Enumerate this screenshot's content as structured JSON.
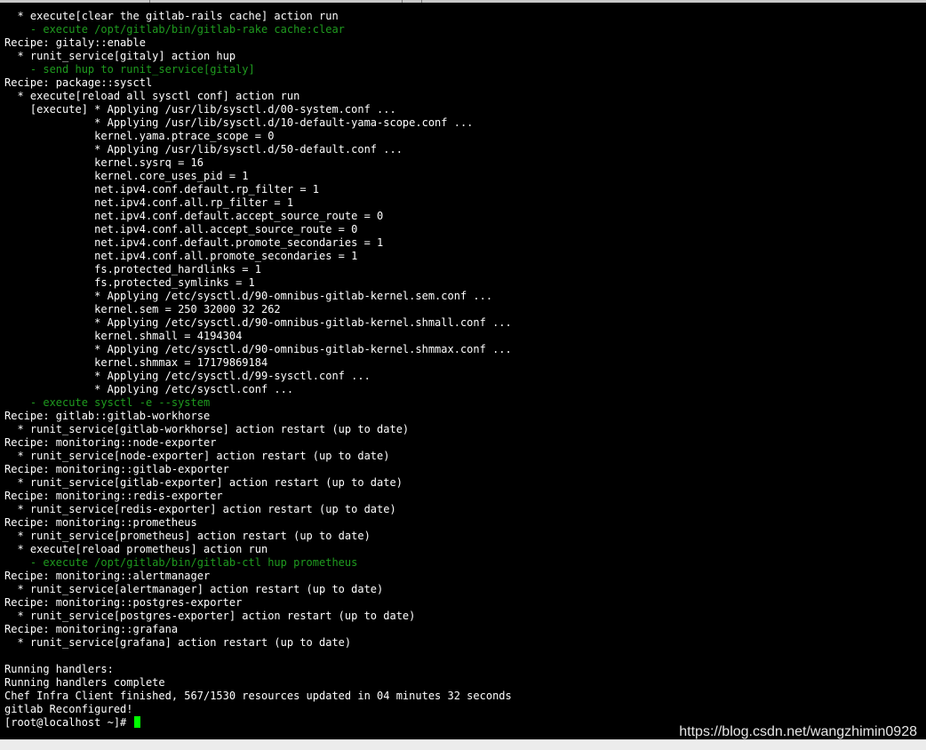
{
  "terminal": {
    "text_color": "#ffffff",
    "dim_color": "#1f9b1f",
    "cursor_color": "#00ff00",
    "lines": [
      {
        "text": "  * execute[clear the gitlab-rails cache] action run",
        "style": "normal"
      },
      {
        "text": "    - execute /opt/gitlab/bin/gitlab-rake cache:clear",
        "style": "green"
      },
      {
        "text": "Recipe: gitaly::enable",
        "style": "normal"
      },
      {
        "text": "  * runit_service[gitaly] action hup",
        "style": "normal"
      },
      {
        "text": "    - send hup to runit_service[gitaly]",
        "style": "green"
      },
      {
        "text": "Recipe: package::sysctl",
        "style": "normal"
      },
      {
        "text": "  * execute[reload all sysctl conf] action run",
        "style": "normal"
      },
      {
        "text": "    [execute] * Applying /usr/lib/sysctl.d/00-system.conf ...",
        "style": "normal"
      },
      {
        "text": "              * Applying /usr/lib/sysctl.d/10-default-yama-scope.conf ...",
        "style": "normal"
      },
      {
        "text": "              kernel.yama.ptrace_scope = 0",
        "style": "normal"
      },
      {
        "text": "              * Applying /usr/lib/sysctl.d/50-default.conf ...",
        "style": "normal"
      },
      {
        "text": "              kernel.sysrq = 16",
        "style": "normal"
      },
      {
        "text": "              kernel.core_uses_pid = 1",
        "style": "normal"
      },
      {
        "text": "              net.ipv4.conf.default.rp_filter = 1",
        "style": "normal"
      },
      {
        "text": "              net.ipv4.conf.all.rp_filter = 1",
        "style": "normal"
      },
      {
        "text": "              net.ipv4.conf.default.accept_source_route = 0",
        "style": "normal"
      },
      {
        "text": "              net.ipv4.conf.all.accept_source_route = 0",
        "style": "normal"
      },
      {
        "text": "              net.ipv4.conf.default.promote_secondaries = 1",
        "style": "normal"
      },
      {
        "text": "              net.ipv4.conf.all.promote_secondaries = 1",
        "style": "normal"
      },
      {
        "text": "              fs.protected_hardlinks = 1",
        "style": "normal"
      },
      {
        "text": "              fs.protected_symlinks = 1",
        "style": "normal"
      },
      {
        "text": "              * Applying /etc/sysctl.d/90-omnibus-gitlab-kernel.sem.conf ...",
        "style": "normal"
      },
      {
        "text": "              kernel.sem = 250 32000 32 262",
        "style": "normal"
      },
      {
        "text": "              * Applying /etc/sysctl.d/90-omnibus-gitlab-kernel.shmall.conf ...",
        "style": "normal"
      },
      {
        "text": "              kernel.shmall = 4194304",
        "style": "normal"
      },
      {
        "text": "              * Applying /etc/sysctl.d/90-omnibus-gitlab-kernel.shmmax.conf ...",
        "style": "normal"
      },
      {
        "text": "              kernel.shmmax = 17179869184",
        "style": "normal"
      },
      {
        "text": "              * Applying /etc/sysctl.d/99-sysctl.conf ...",
        "style": "normal"
      },
      {
        "text": "              * Applying /etc/sysctl.conf ...",
        "style": "normal"
      },
      {
        "text": "    - execute sysctl -e --system",
        "style": "green"
      },
      {
        "text": "Recipe: gitlab::gitlab-workhorse",
        "style": "normal"
      },
      {
        "text": "  * runit_service[gitlab-workhorse] action restart (up to date)",
        "style": "normal"
      },
      {
        "text": "Recipe: monitoring::node-exporter",
        "style": "normal"
      },
      {
        "text": "  * runit_service[node-exporter] action restart (up to date)",
        "style": "normal"
      },
      {
        "text": "Recipe: monitoring::gitlab-exporter",
        "style": "normal"
      },
      {
        "text": "  * runit_service[gitlab-exporter] action restart (up to date)",
        "style": "normal"
      },
      {
        "text": "Recipe: monitoring::redis-exporter",
        "style": "normal"
      },
      {
        "text": "  * runit_service[redis-exporter] action restart (up to date)",
        "style": "normal"
      },
      {
        "text": "Recipe: monitoring::prometheus",
        "style": "normal"
      },
      {
        "text": "  * runit_service[prometheus] action restart (up to date)",
        "style": "normal"
      },
      {
        "text": "  * execute[reload prometheus] action run",
        "style": "normal"
      },
      {
        "text": "    - execute /opt/gitlab/bin/gitlab-ctl hup prometheus",
        "style": "green"
      },
      {
        "text": "Recipe: monitoring::alertmanager",
        "style": "normal"
      },
      {
        "text": "  * runit_service[alertmanager] action restart (up to date)",
        "style": "normal"
      },
      {
        "text": "Recipe: monitoring::postgres-exporter",
        "style": "normal"
      },
      {
        "text": "  * runit_service[postgres-exporter] action restart (up to date)",
        "style": "normal"
      },
      {
        "text": "Recipe: monitoring::grafana",
        "style": "normal"
      },
      {
        "text": "  * runit_service[grafana] action restart (up to date)",
        "style": "normal"
      },
      {
        "text": "",
        "style": "normal"
      },
      {
        "text": "Running handlers:",
        "style": "normal"
      },
      {
        "text": "Running handlers complete",
        "style": "normal"
      },
      {
        "text": "Chef Infra Client finished, 567/1530 resources updated in 04 minutes 32 seconds",
        "style": "normal"
      },
      {
        "text": "gitlab Reconfigured!",
        "style": "normal"
      }
    ],
    "prompt": "[root@localhost ~]# "
  },
  "watermark": "https://blog.csdn.net/wangzhimin0928"
}
